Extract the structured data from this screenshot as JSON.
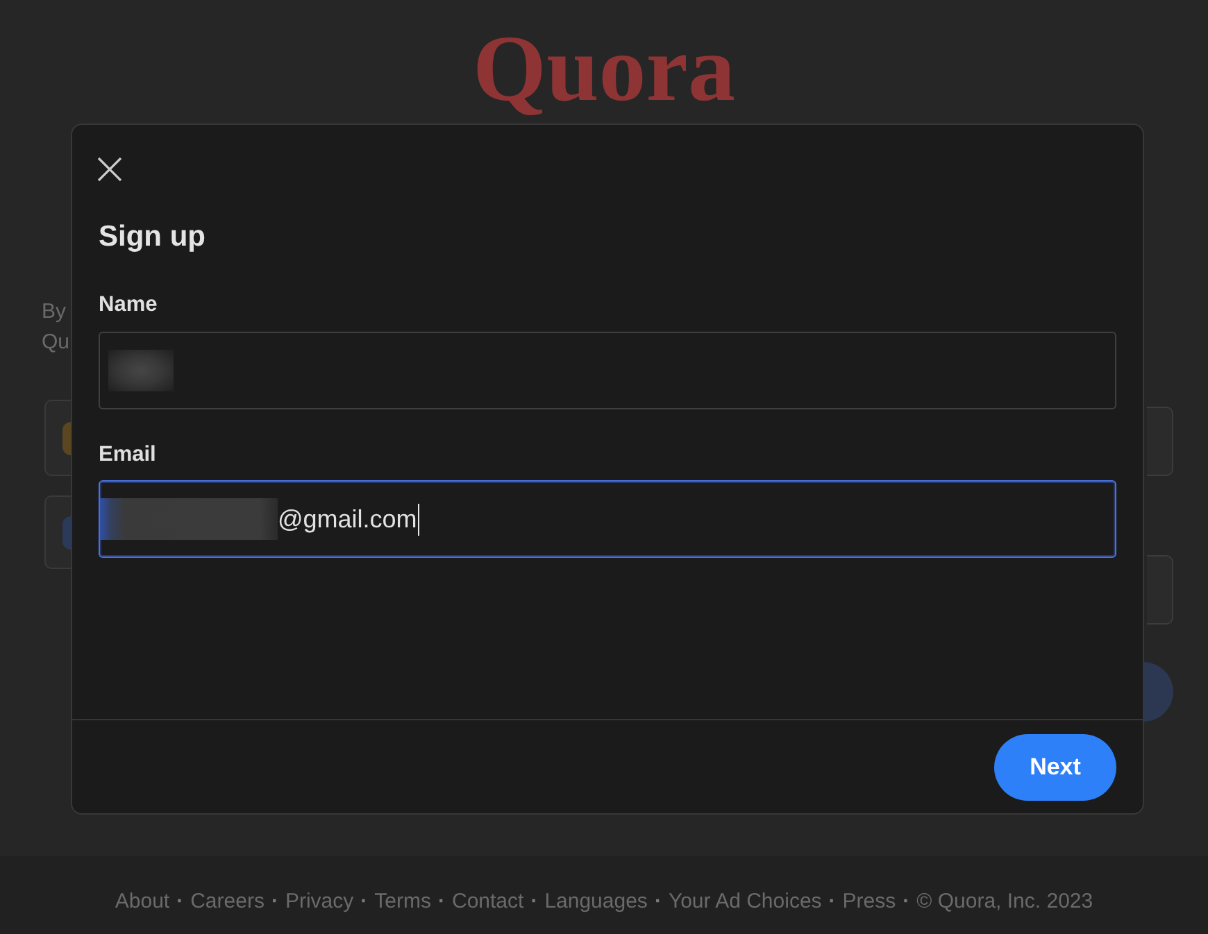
{
  "page": {
    "logo": "Quora",
    "text_fragments": [
      "By",
      "Qu"
    ]
  },
  "modal": {
    "title": "Sign up",
    "fields": [
      {
        "label": "Name",
        "redacted": true,
        "focused": false
      },
      {
        "label": "Email",
        "redacted": true,
        "value": "@gmail.com",
        "focused": true
      }
    ],
    "next_button": {
      "label": "Next"
    }
  },
  "footer": {
    "separator": "·",
    "links": [
      "About",
      "Careers",
      "Privacy",
      "Terms",
      "Contact",
      "Languages",
      "Your Ad Choices",
      "Press"
    ],
    "copyright": "© Quora, Inc. 2023"
  }
}
